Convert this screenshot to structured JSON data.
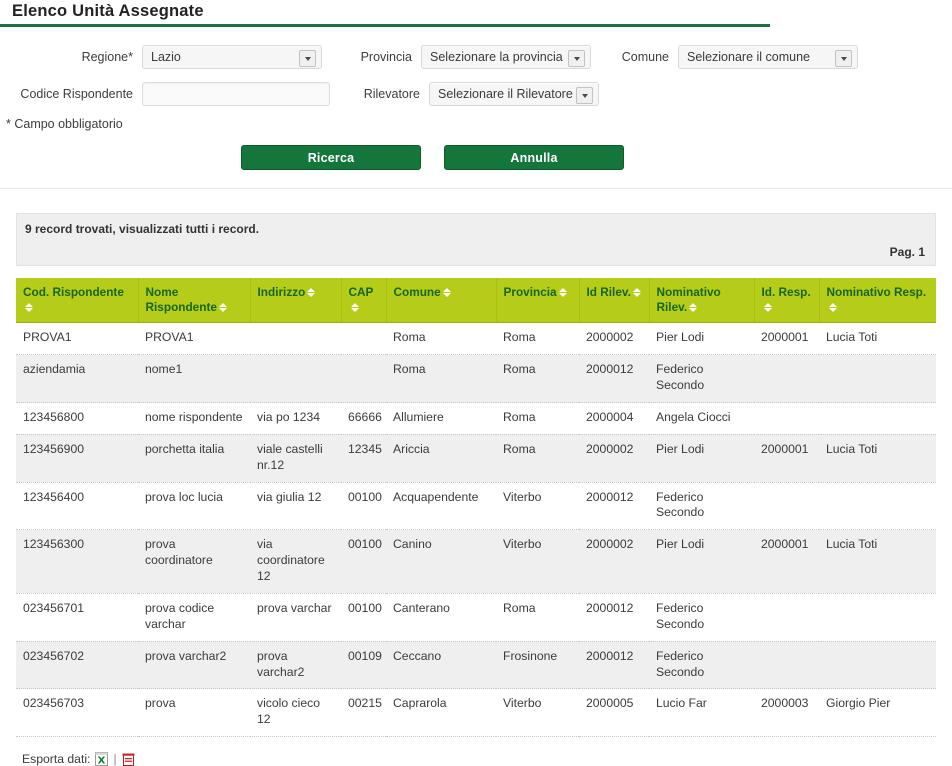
{
  "page": {
    "title": "Elenco Unità Assegnate"
  },
  "search_form": {
    "regione": {
      "label": "Regione*",
      "value": "Lazio"
    },
    "provincia": {
      "label": "Provincia",
      "value": "Selezionare la provincia"
    },
    "comune": {
      "label": "Comune",
      "value": "Selezionare il comune"
    },
    "codice_rispondente": {
      "label": "Codice Rispondente",
      "value": "",
      "placeholder": ""
    },
    "rilevatore": {
      "label": "Rilevatore",
      "value": "Selezionare il Rilevatore"
    },
    "required_note": "* Campo obbligatorio",
    "buttons": {
      "search": "Ricerca",
      "cancel": "Annulla"
    }
  },
  "results": {
    "count_text": "9 record trovati, visualizzati tutti i record.",
    "page_text": "Pag. 1",
    "columns": [
      "Cod. Rispondente",
      "Nome Rispondente",
      "Indirizzo",
      "CAP",
      "Comune",
      "Provincia",
      "Id Rilev.",
      "Nominativo Rilev.",
      "Id. Resp.",
      "Nominativo Resp."
    ],
    "rows": [
      {
        "cod_rispondente": "PROVA1",
        "nome_rispondente": "PROVA1",
        "indirizzo": "",
        "cap": "",
        "comune": "Roma",
        "provincia": "Roma",
        "id_rilev": "2000002",
        "nominativo_rilev": "Pier Lodi",
        "id_resp": "2000001",
        "nominativo_resp": "Lucia Toti"
      },
      {
        "cod_rispondente": "aziendamia",
        "nome_rispondente": "nome1",
        "indirizzo": "",
        "cap": "",
        "comune": "Roma",
        "provincia": "Roma",
        "id_rilev": "2000012",
        "nominativo_rilev": "Federico Secondo",
        "id_resp": "",
        "nominativo_resp": ""
      },
      {
        "cod_rispondente": "123456800",
        "nome_rispondente": "nome rispondente",
        "indirizzo": "via po 1234",
        "cap": "66666",
        "comune": "Allumiere",
        "provincia": "Roma",
        "id_rilev": "2000004",
        "nominativo_rilev": "Angela Ciocci",
        "id_resp": "",
        "nominativo_resp": ""
      },
      {
        "cod_rispondente": "123456900",
        "nome_rispondente": "porchetta italia",
        "indirizzo": "viale castelli nr.12",
        "cap": "12345",
        "comune": "Ariccia",
        "provincia": "Roma",
        "id_rilev": "2000002",
        "nominativo_rilev": "Pier Lodi",
        "id_resp": "2000001",
        "nominativo_resp": "Lucia Toti"
      },
      {
        "cod_rispondente": "123456400",
        "nome_rispondente": "prova loc lucia",
        "indirizzo": "via giulia 12",
        "cap": "00100",
        "comune": "Acquapendente",
        "provincia": "Viterbo",
        "id_rilev": "2000012",
        "nominativo_rilev": "Federico Secondo",
        "id_resp": "",
        "nominativo_resp": ""
      },
      {
        "cod_rispondente": "123456300",
        "nome_rispondente": "prova coordinatore",
        "indirizzo": "via coordinatore 12",
        "cap": "00100",
        "comune": "Canino",
        "provincia": "Viterbo",
        "id_rilev": "2000002",
        "nominativo_rilev": "Pier Lodi",
        "id_resp": "2000001",
        "nominativo_resp": "Lucia Toti"
      },
      {
        "cod_rispondente": "023456701",
        "nome_rispondente": "prova codice varchar",
        "indirizzo": "prova varchar",
        "cap": "00100",
        "comune": "Canterano",
        "provincia": "Roma",
        "id_rilev": "2000012",
        "nominativo_rilev": "Federico Secondo",
        "id_resp": "",
        "nominativo_resp": ""
      },
      {
        "cod_rispondente": "023456702",
        "nome_rispondente": "prova varchar2",
        "indirizzo": "prova varchar2",
        "cap": "00109",
        "comune": "Ceccano",
        "provincia": "Frosinone",
        "id_rilev": "2000012",
        "nominativo_rilev": "Federico Secondo",
        "id_resp": "",
        "nominativo_resp": ""
      },
      {
        "cod_rispondente": "023456703",
        "nome_rispondente": "prova",
        "indirizzo": "vicolo cieco 12",
        "cap": "00215",
        "comune": "Caprarola",
        "provincia": "Viterbo",
        "id_rilev": "2000005",
        "nominativo_rilev": "Lucio Far",
        "id_resp": "2000003",
        "nominativo_resp": "Giorgio Pier"
      }
    ]
  },
  "export": {
    "label": "Esporta dati:",
    "separator": "|",
    "excel_icon": "excel-icon",
    "pdf_icon": "pdf-icon"
  },
  "colors": {
    "accent_green": "#1d7044",
    "button_green": "#14763a",
    "header_bg": "#b5cc18",
    "header_text": "#18661b",
    "row_alt": "#efefef"
  }
}
